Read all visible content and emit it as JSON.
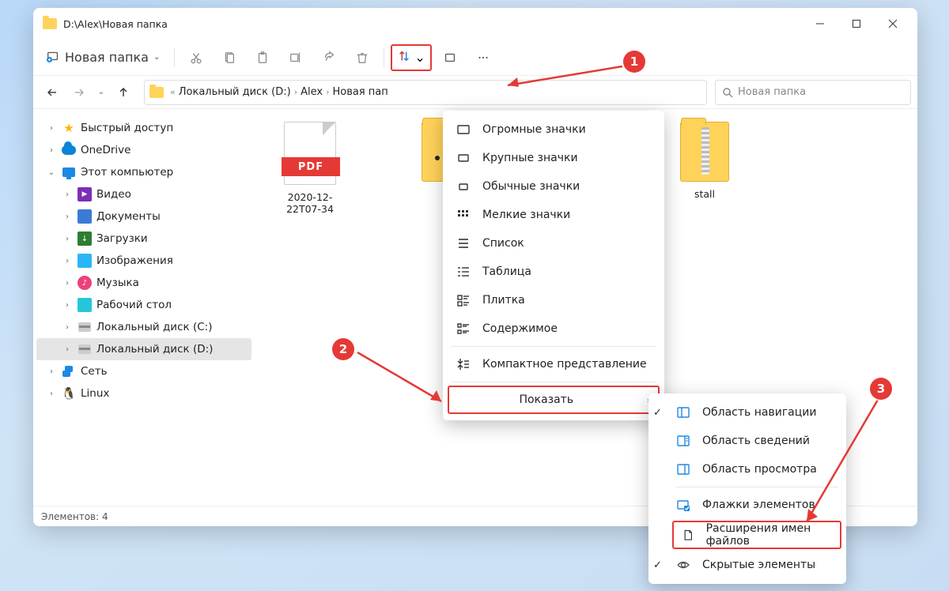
{
  "window": {
    "title": "D:\\Alex\\Новая папка"
  },
  "toolbar": {
    "new_label": "Новая папка"
  },
  "breadcrumb": {
    "drive": "Локальный диск (D:)",
    "folder1": "Alex",
    "folder2": "Новая пап"
  },
  "search": {
    "placeholder": "Новая папка"
  },
  "sidebar": {
    "quick": "Быстрый доступ",
    "onedrive": "OneDrive",
    "thispc": "Этот компьютер",
    "videos": "Видео",
    "documents": "Документы",
    "downloads": "Загрузки",
    "pictures": "Изображения",
    "music": "Музыка",
    "desktop": "Рабочий стол",
    "disk_c": "Локальный диск (C:)",
    "disk_d": "Локальный диск (D:)",
    "network": "Сеть",
    "linux": "Linux"
  },
  "files": {
    "pdf_label": "PDF",
    "pdf_name": "2020-12-22T07-34",
    "zip2_name": "stall"
  },
  "status": {
    "text": "Элементов: 4"
  },
  "view_menu": {
    "extra_large": "Огромные значки",
    "large": "Крупные значки",
    "medium": "Обычные значки",
    "small": "Мелкие значки",
    "list": "Список",
    "details": "Таблица",
    "tiles": "Плитка",
    "content": "Содержимое",
    "compact": "Компактное представление",
    "show": "Показать"
  },
  "show_menu": {
    "nav_pane": "Область навигации",
    "details_pane": "Область сведений",
    "preview_pane": "Область просмотра",
    "checkboxes": "Флажки элементов",
    "extensions": "Расширения имен файлов",
    "hidden": "Скрытые элементы"
  },
  "callout": {
    "c1": "1",
    "c2": "2",
    "c3": "3"
  }
}
